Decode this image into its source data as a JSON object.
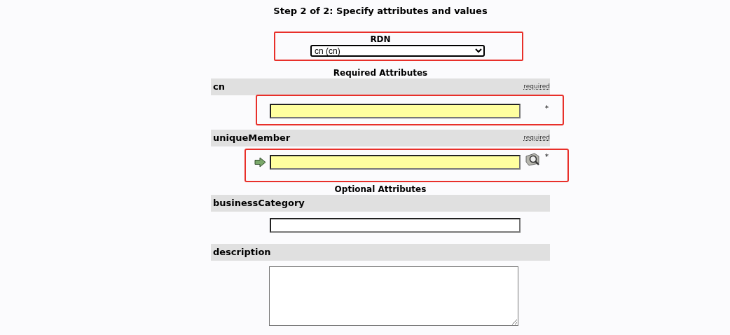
{
  "title": "Step 2 of 2: Specify attributes and values",
  "rdn": {
    "label": "RDN",
    "value": "cn (cn)",
    "highlighted": true
  },
  "sections": [
    {
      "heading": "Required Attributes",
      "attributes": [
        {
          "name": "cn",
          "badge": "required",
          "kind": "text",
          "required": true,
          "marker": "*",
          "arrow": false,
          "lookup": false,
          "highlighted": true
        },
        {
          "name": "uniqueMember",
          "badge": "required",
          "kind": "text",
          "required": true,
          "marker": "*",
          "arrow": true,
          "lookup": true,
          "highlighted": true
        }
      ]
    },
    {
      "heading": "Optional Attributes",
      "attributes": [
        {
          "name": "businessCategory",
          "kind": "text",
          "required": false,
          "arrow": false,
          "lookup": false,
          "highlighted": false
        },
        {
          "name": "description",
          "kind": "textarea",
          "required": false,
          "arrow": false,
          "lookup": false,
          "highlighted": false
        }
      ]
    }
  ]
}
